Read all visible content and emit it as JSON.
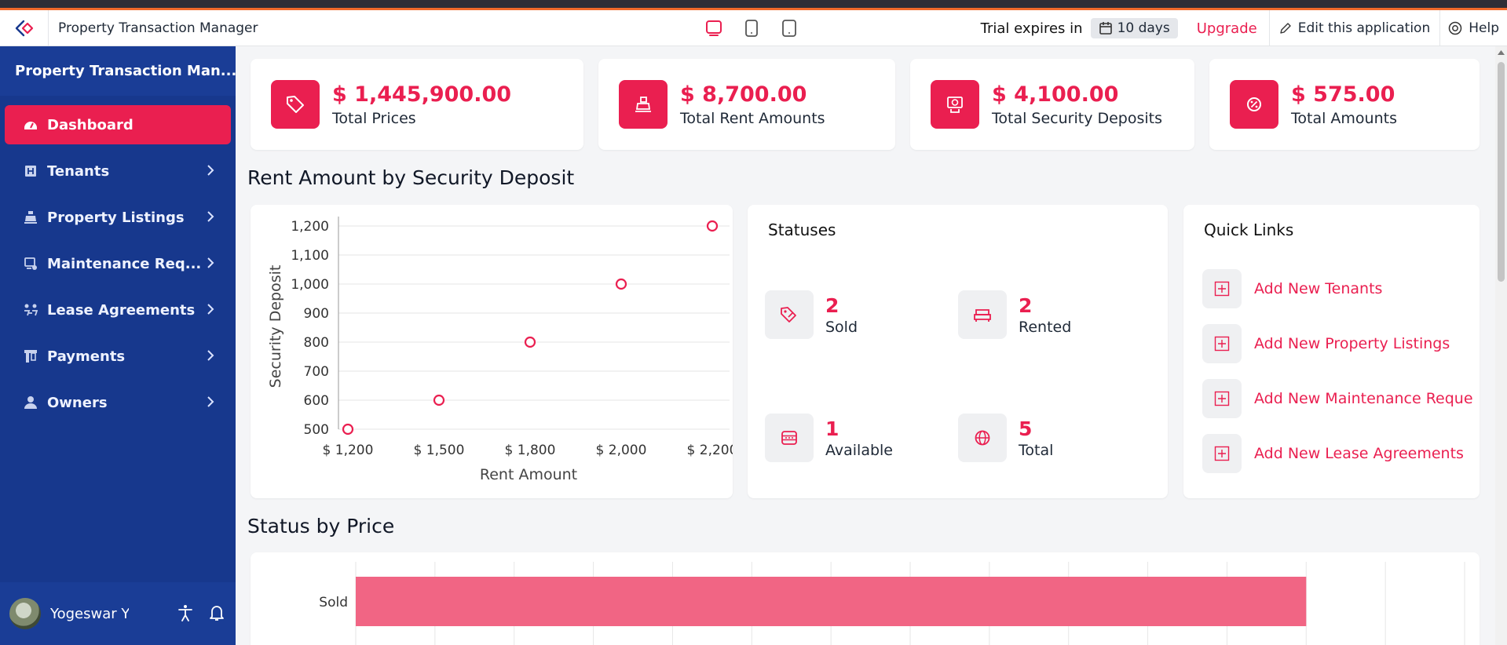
{
  "topbar": {
    "app_title": "Property Transaction Manager",
    "trial_label": "Trial expires in",
    "trial_days": "10 days",
    "upgrade": "Upgrade",
    "edit_app": "Edit this application",
    "help": "Help"
  },
  "sidebar": {
    "app_name": "Property Transaction Man...",
    "items": [
      {
        "label": "Dashboard",
        "icon": "dashboard-icon",
        "active": true
      },
      {
        "label": "Tenants",
        "icon": "tenants-icon"
      },
      {
        "label": "Property Listings",
        "icon": "property-listings-icon"
      },
      {
        "label": "Maintenance Req...",
        "icon": "maintenance-icon"
      },
      {
        "label": "Lease Agreements",
        "icon": "lease-icon"
      },
      {
        "label": "Payments",
        "icon": "payments-icon"
      },
      {
        "label": "Owners",
        "icon": "owners-icon"
      }
    ],
    "user_name": "Yogeswar Yo..."
  },
  "stats": [
    {
      "value": "$ 1,445,900.00",
      "label": "Total Prices",
      "icon": "tag-icon"
    },
    {
      "value": "$ 8,700.00",
      "label": "Total Rent Amounts",
      "icon": "cashier-icon"
    },
    {
      "value": "$ 4,100.00",
      "label": "Total Security Deposits",
      "icon": "deposit-icon"
    },
    {
      "value": "$ 575.00",
      "label": "Total Amounts",
      "icon": "percent-icon"
    }
  ],
  "sections": {
    "rent_chart_title": "Rent Amount by Security Deposit",
    "status_price_title": "Status by Price"
  },
  "statuses": {
    "title": "Statuses",
    "items": [
      {
        "value": "2",
        "label": "Sold",
        "icon": "sold-tag-icon"
      },
      {
        "value": "2",
        "label": "Rented",
        "icon": "bed-icon"
      },
      {
        "value": "1",
        "label": "Available",
        "icon": "available-icon"
      },
      {
        "value": "5",
        "label": "Total",
        "icon": "globe-icon"
      }
    ]
  },
  "quick_links": {
    "title": "Quick Links",
    "items": [
      {
        "label": "Add New Tenants"
      },
      {
        "label": "Add New Property Listings"
      },
      {
        "label": "Add New Maintenance Reque"
      },
      {
        "label": "Add New Lease Agreements"
      }
    ]
  },
  "colors": {
    "accent": "#ea1f50",
    "sidebar": "#17388d",
    "bar": "#f16584"
  },
  "chart_data": [
    {
      "type": "scatter",
      "xlabel": "Rent Amount",
      "ylabel": "Security Deposit",
      "x_ticks": [
        "$ 1,200",
        "$ 1,500",
        "$ 1,800",
        "$ 2,000",
        "$ 2,200"
      ],
      "y_ticks": [
        "1,200",
        "1,100",
        "1,000",
        "900",
        "800",
        "700",
        "600",
        "500"
      ],
      "x_categories": [
        1200,
        1500,
        1800,
        2000,
        2200
      ],
      "ylim": [
        500,
        1200
      ],
      "points": [
        {
          "x": 1200,
          "y": 500
        },
        {
          "x": 1500,
          "y": 600
        },
        {
          "x": 1800,
          "y": 800
        },
        {
          "x": 2000,
          "y": 1000
        },
        {
          "x": 2200,
          "y": 1200
        }
      ],
      "grid": true
    },
    {
      "type": "bar",
      "orientation": "horizontal",
      "categories": [
        "Sold"
      ],
      "values": [
        1200000
      ],
      "xlim": [
        0,
        1400000
      ],
      "grid": true
    }
  ]
}
